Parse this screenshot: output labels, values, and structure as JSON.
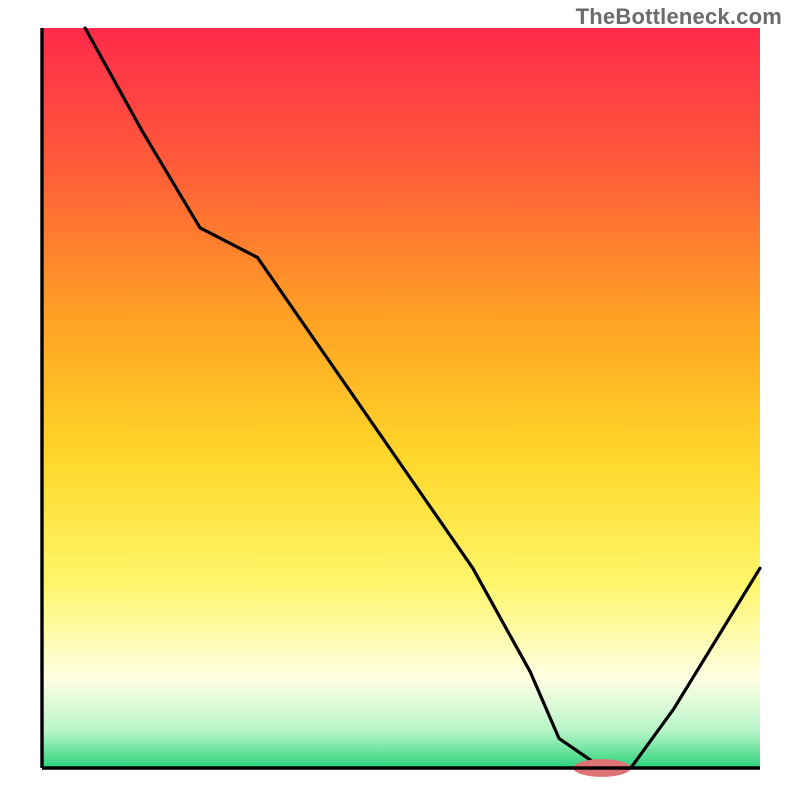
{
  "watermark": "TheBottleneck.com",
  "chart_data": {
    "type": "line",
    "title": "",
    "xlabel": "",
    "ylabel": "",
    "xlim": [
      0,
      100
    ],
    "ylim": [
      0,
      100
    ],
    "grid": false,
    "legend": false,
    "series": [
      {
        "name": "bottleneck-curve",
        "x": [
          6,
          14,
          22,
          30,
          40,
          50,
          60,
          68,
          72,
          78,
          82,
          88,
          100
        ],
        "y": [
          100,
          86,
          73,
          69,
          55,
          41,
          27,
          13,
          4,
          0,
          0,
          8,
          27
        ]
      }
    ],
    "marker": {
      "name": "optimal-marker",
      "cx": 78,
      "cy": 0,
      "rx": 4,
      "ry": 1.2,
      "color": "#de7277"
    },
    "colors": {
      "gradient_top": "#ff2a4a",
      "gradient_mid_upper": "#ff8e2f",
      "gradient_mid": "#ffd72a",
      "gradient_mid_lower": "#f9ff87",
      "gradient_low": "#ffffe5",
      "gradient_bottom": "#2bd37a",
      "curve": "#000000",
      "marker": "#de7277"
    }
  }
}
